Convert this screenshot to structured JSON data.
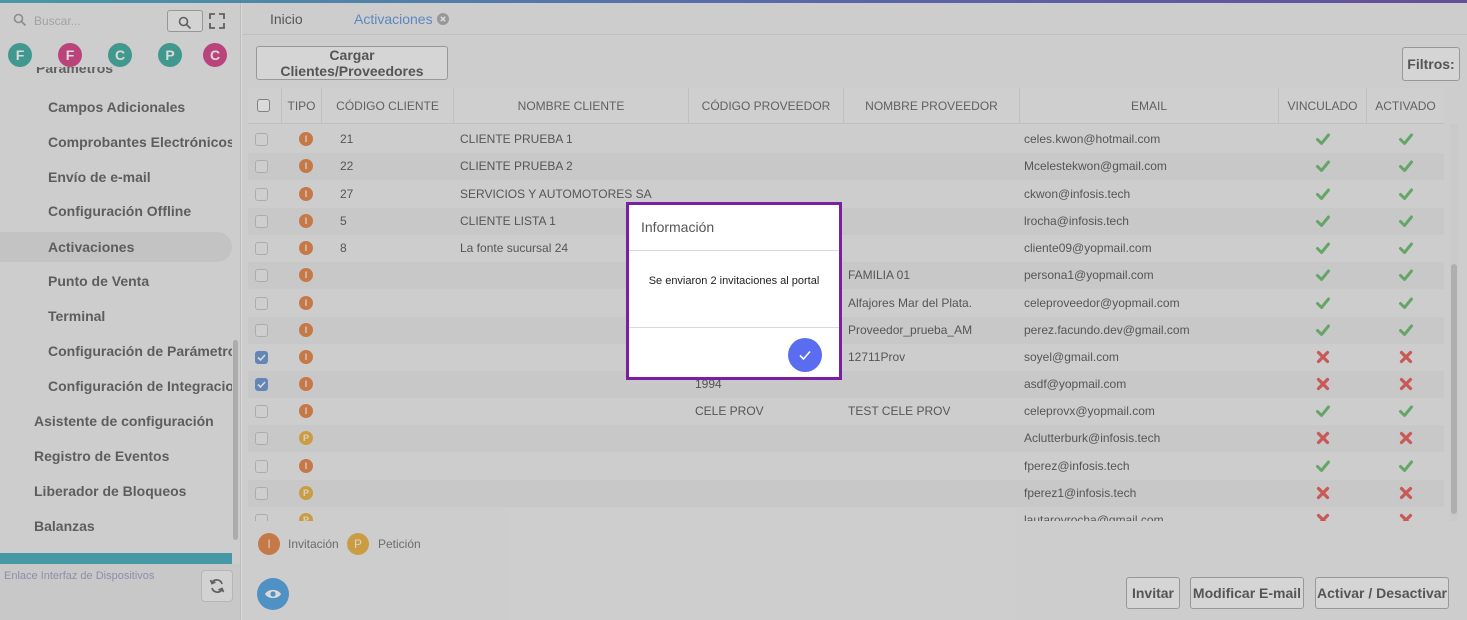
{
  "sidebar": {
    "search_placeholder": "Buscar...",
    "favorites": [
      {
        "letter": "F",
        "color": "#139a8d"
      },
      {
        "letter": "F",
        "color": "#d0186f"
      },
      {
        "letter": "C",
        "color": "#139a8d"
      },
      {
        "letter": "P",
        "color": "#139a8d"
      },
      {
        "letter": "C",
        "color": "#d0186f"
      }
    ],
    "partial_header": "Parámetros",
    "items": [
      {
        "label": "Campos Adicionales",
        "level": "sub",
        "active": false
      },
      {
        "label": "Comprobantes Electrónicos",
        "level": "sub",
        "active": false
      },
      {
        "label": "Envío de e-mail",
        "level": "sub",
        "active": false
      },
      {
        "label": "Configuración Offline",
        "level": "sub",
        "active": false
      },
      {
        "label": "Activaciones",
        "level": "sub",
        "active": true
      },
      {
        "label": "Punto de Venta",
        "level": "sub",
        "active": false
      },
      {
        "label": "Terminal",
        "level": "sub",
        "active": false
      },
      {
        "label": "Configuración de Parámetros",
        "level": "sub",
        "active": false
      },
      {
        "label": "Configuración de Integraciones",
        "level": "sub",
        "active": false
      },
      {
        "label": "Asistente de configuración",
        "level": "top",
        "active": false
      },
      {
        "label": "Registro de Eventos",
        "level": "top",
        "active": false
      },
      {
        "label": "Liberador de Bloqueos",
        "level": "top",
        "active": false
      },
      {
        "label": "Balanzas",
        "level": "top",
        "active": false
      }
    ],
    "footer_link": "Enlace Interfaz de Dispositivos"
  },
  "tabs": [
    {
      "label": "Inicio"
    },
    {
      "label": "Activaciones"
    }
  ],
  "toolbar": {
    "cargar_label": "Cargar Clientes/Proveedores",
    "filtros_label": "Filtros:"
  },
  "table": {
    "columns": [
      "TIPO",
      "CÓDIGO CLIENTE",
      "NOMBRE CLIENTE",
      "CÓDIGO PROVEEDOR",
      "NOMBRE PROVEEDOR",
      "EMAIL",
      "VINCULADO",
      "ACTIVADO"
    ],
    "rows": [
      {
        "checked": false,
        "tipo": "I",
        "codigo_cliente": "21",
        "nombre_cliente": "CLIENTE PRUEBA 1",
        "codigo_proveedor": "",
        "nombre_proveedor": "",
        "email": "celes.kwon@hotmail.com",
        "vinculado": true,
        "activado": true
      },
      {
        "checked": false,
        "tipo": "I",
        "codigo_cliente": "22",
        "nombre_cliente": "CLIENTE PRUEBA 2",
        "codigo_proveedor": "",
        "nombre_proveedor": "",
        "email": "Mcelestekwon@gmail.com",
        "vinculado": true,
        "activado": true
      },
      {
        "checked": false,
        "tipo": "I",
        "codigo_cliente": "27",
        "nombre_cliente": "SERVICIOS Y AUTOMOTORES SA",
        "codigo_proveedor": "",
        "nombre_proveedor": "",
        "email": "ckwon@infosis.tech",
        "vinculado": true,
        "activado": true
      },
      {
        "checked": false,
        "tipo": "I",
        "codigo_cliente": "5",
        "nombre_cliente": "CLIENTE LISTA 1",
        "codigo_proveedor": "",
        "nombre_proveedor": "",
        "email": "lrocha@infosis.tech",
        "vinculado": true,
        "activado": true
      },
      {
        "checked": false,
        "tipo": "I",
        "codigo_cliente": "8",
        "nombre_cliente": "La fonte sucursal 24",
        "codigo_proveedor": "",
        "nombre_proveedor": "",
        "email": "cliente09@yopmail.com",
        "vinculado": true,
        "activado": true
      },
      {
        "checked": false,
        "tipo": "I",
        "codigo_cliente": "",
        "nombre_cliente": "",
        "codigo_proveedor": "",
        "nombre_proveedor": "FAMILIA 01",
        "email": "persona1@yopmail.com",
        "vinculado": true,
        "activado": true
      },
      {
        "checked": false,
        "tipo": "I",
        "codigo_cliente": "",
        "nombre_cliente": "",
        "codigo_proveedor": "",
        "nombre_proveedor": "Alfajores Mar del Plata.",
        "email": "celeproveedor@yopmail.com",
        "vinculado": true,
        "activado": true
      },
      {
        "checked": false,
        "tipo": "I",
        "codigo_cliente": "",
        "nombre_cliente": "",
        "codigo_proveedor": "",
        "nombre_proveedor": "Proveedor_prueba_AM",
        "email": "perez.facundo.dev@gmail.com",
        "vinculado": true,
        "activado": true
      },
      {
        "checked": true,
        "tipo": "I",
        "codigo_cliente": "",
        "nombre_cliente": "",
        "codigo_proveedor": "",
        "nombre_proveedor": "12711Prov",
        "email": "soyel@gmail.com",
        "vinculado": false,
        "activado": false
      },
      {
        "checked": true,
        "tipo": "I",
        "codigo_cliente": "",
        "nombre_cliente": "",
        "codigo_proveedor": "1994",
        "nombre_proveedor": "",
        "email": "asdf@yopmail.com",
        "vinculado": false,
        "activado": false
      },
      {
        "checked": false,
        "tipo": "I",
        "codigo_cliente": "",
        "nombre_cliente": "",
        "codigo_proveedor": "CELE PROV",
        "nombre_proveedor": "TEST CELE PROV",
        "email": "celeprovx@yopmail.com",
        "vinculado": true,
        "activado": true
      },
      {
        "checked": false,
        "tipo": "P",
        "codigo_cliente": "",
        "nombre_cliente": "",
        "codigo_proveedor": "",
        "nombre_proveedor": "",
        "email": "Aclutterburk@infosis.tech",
        "vinculado": false,
        "activado": false
      },
      {
        "checked": false,
        "tipo": "I",
        "codigo_cliente": "",
        "nombre_cliente": "",
        "codigo_proveedor": "",
        "nombre_proveedor": "",
        "email": "fperez@infosis.tech",
        "vinculado": true,
        "activado": true
      },
      {
        "checked": false,
        "tipo": "P",
        "codigo_cliente": "",
        "nombre_cliente": "",
        "codigo_proveedor": "",
        "nombre_proveedor": "",
        "email": "fperez1@infosis.tech",
        "vinculado": false,
        "activado": false
      },
      {
        "checked": false,
        "tipo": "P",
        "codigo_cliente": "",
        "nombre_cliente": "",
        "codigo_proveedor": "",
        "nombre_proveedor": "",
        "email": "lautarovrocha@gmail.com",
        "vinculado": false,
        "activado": false
      }
    ]
  },
  "legend": {
    "invitacion": {
      "letter": "I",
      "label": "Invitación",
      "color": "#e06b1f"
    },
    "peticion": {
      "letter": "P",
      "label": "Petición",
      "color": "#e6a21a"
    }
  },
  "actions": {
    "invitar_label": "Invitar",
    "modificar_label": "Modificar E-mail",
    "activar_label": "Activar / Desactivar"
  },
  "dialog": {
    "title": "Información",
    "message": "Se enviaron 2 invitaciones al portal"
  },
  "colors": {
    "check_green": "#4caf50",
    "cross_red": "#e53935",
    "accent_blue": "#3f7fd6",
    "dialog_border": "#7b1fa2",
    "ok_button": "#5a6df0"
  }
}
